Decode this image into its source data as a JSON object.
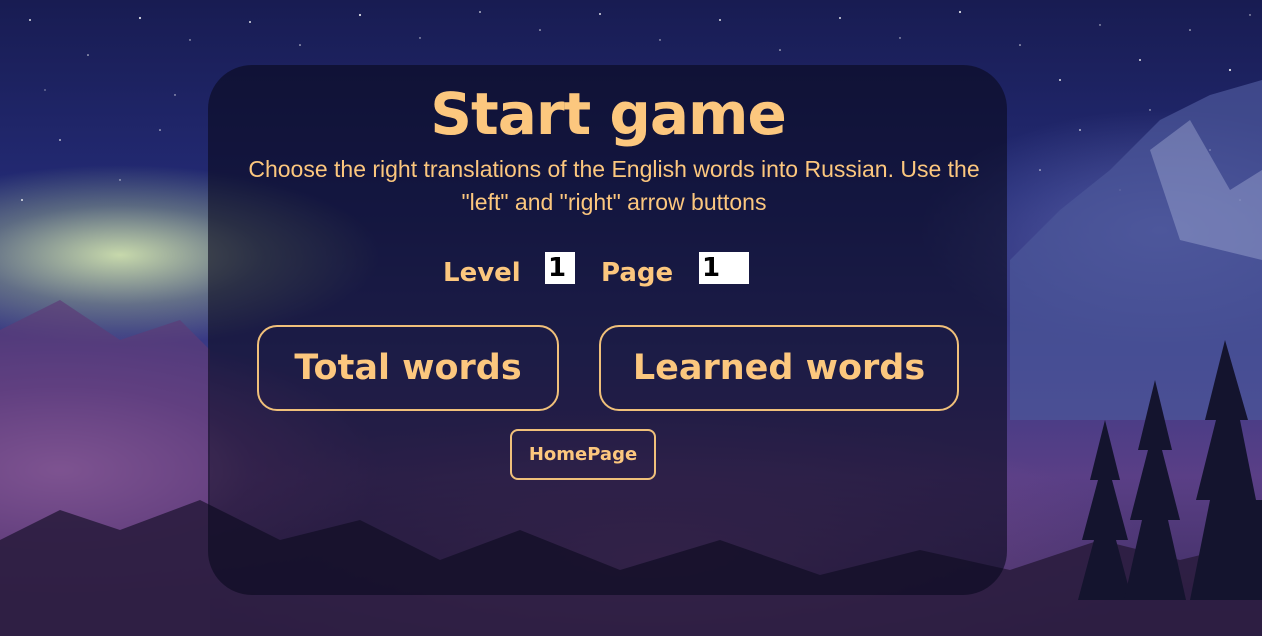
{
  "game": {
    "title": "Start game",
    "description": "Choose the right translations of the English words into Russian. Use the \"left\" and \"right\" arrow buttons"
  },
  "settings": {
    "level_label": "Level",
    "level_value": "1",
    "page_label": "Page",
    "page_value": "1"
  },
  "buttons": {
    "total_words": "Total words",
    "learned_words": "Learned words",
    "homepage": "HomePage"
  },
  "colors": {
    "accent": "#fcc77e",
    "panel": "#0a0a1e"
  }
}
